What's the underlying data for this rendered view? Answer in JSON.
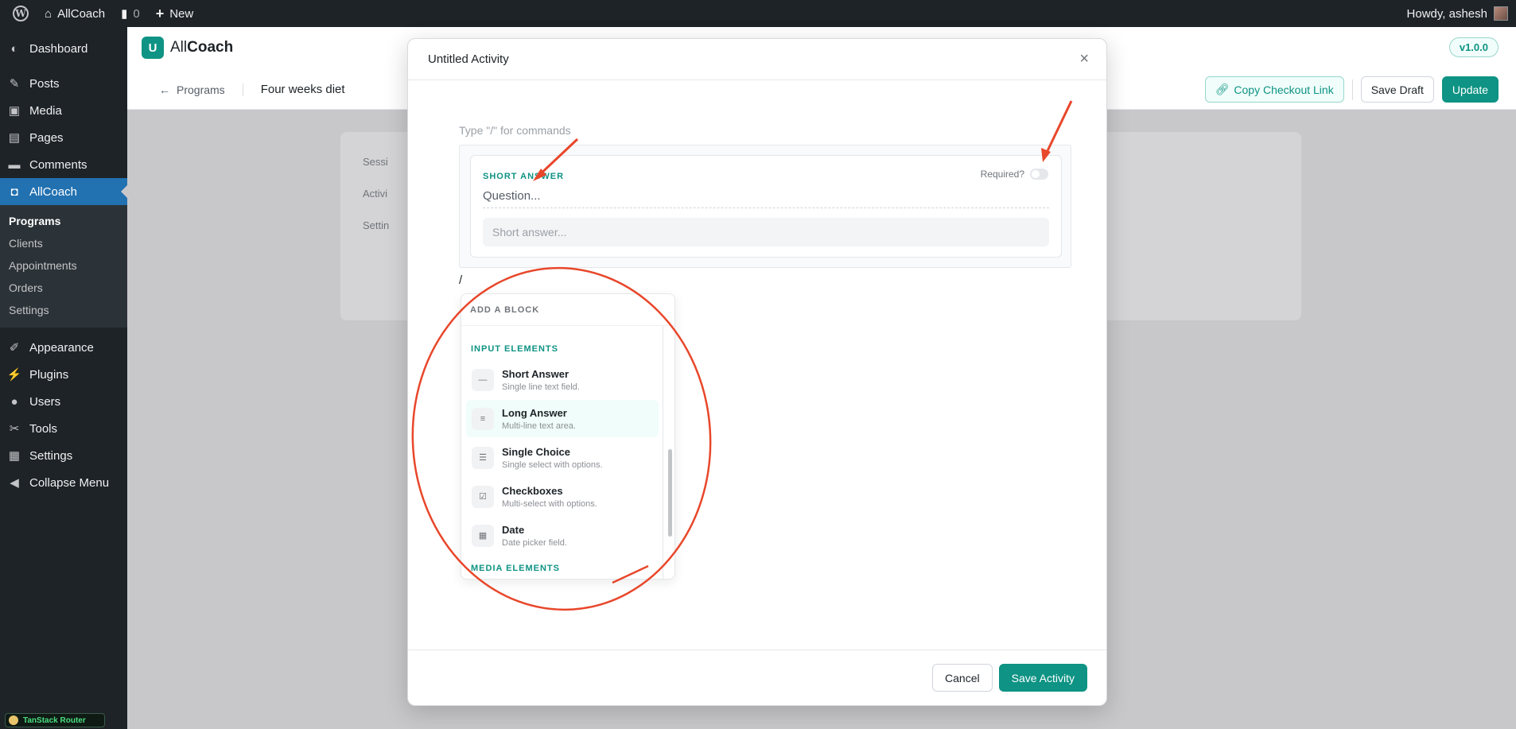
{
  "adminbar": {
    "site_name": "AllCoach",
    "comments_count": "0",
    "new_label": "New",
    "howdy": "Howdy, ashesh"
  },
  "sidebar": {
    "items_top": [
      {
        "label": "Dashboard",
        "icon": "dashboard-icon"
      },
      {
        "label": "Posts",
        "icon": "pin-icon"
      },
      {
        "label": "Media",
        "icon": "media-icon"
      },
      {
        "label": "Pages",
        "icon": "pages-icon"
      },
      {
        "label": "Comments",
        "icon": "comment-icon"
      },
      {
        "label": "AllCoach",
        "icon": "allcoach-icon"
      }
    ],
    "submenu": [
      "Programs",
      "Clients",
      "Appointments",
      "Orders",
      "Settings"
    ],
    "items_bottom": [
      {
        "label": "Appearance",
        "icon": "brush-icon"
      },
      {
        "label": "Plugins",
        "icon": "plug-icon"
      },
      {
        "label": "Users",
        "icon": "user-icon"
      },
      {
        "label": "Tools",
        "icon": "wrench-icon"
      },
      {
        "label": "Settings",
        "icon": "settings-icon"
      },
      {
        "label": "Collapse Menu",
        "icon": "collapse-icon"
      }
    ],
    "devtool_label": "TanStack Router"
  },
  "app": {
    "logo_light": "All",
    "logo_bold": "Coach",
    "version": "v1.0.0",
    "back_label": "Programs",
    "program_name": "Four weeks diet",
    "copy_link": "Copy Checkout Link",
    "save_draft": "Save Draft",
    "update": "Update",
    "bg_tabs": [
      "Sessi",
      "Activi",
      "Settin"
    ]
  },
  "modal": {
    "title": "Untitled Activity",
    "hint": "Type \"/\" for commands",
    "block": {
      "type_label": "SHORT ANSWER",
      "required_label": "Required?",
      "question_placeholder": "Question...",
      "answer_placeholder": "Short answer..."
    },
    "slash": "/",
    "dropdown": {
      "title": "ADD A BLOCK",
      "section_input": "INPUT ELEMENTS",
      "items": [
        {
          "title": "Short Answer",
          "desc": "Single line text field.",
          "icon": "dash-icon"
        },
        {
          "title": "Long Answer",
          "desc": "Multi-line text area.",
          "icon": "paragraph-icon"
        },
        {
          "title": "Single Choice",
          "desc": "Single select with options.",
          "icon": "list-icon"
        },
        {
          "title": "Checkboxes",
          "desc": "Multi-select with options.",
          "icon": "checkbox-icon"
        },
        {
          "title": "Date",
          "desc": "Date picker field.",
          "icon": "calendar-icon"
        }
      ],
      "section_media": "MEDIA ELEMENTS"
    },
    "cancel": "Cancel",
    "save": "Save Activity"
  },
  "colors": {
    "accent": "#0e9384",
    "wp_blue": "#2271b1",
    "annotation": "#e8472b"
  }
}
